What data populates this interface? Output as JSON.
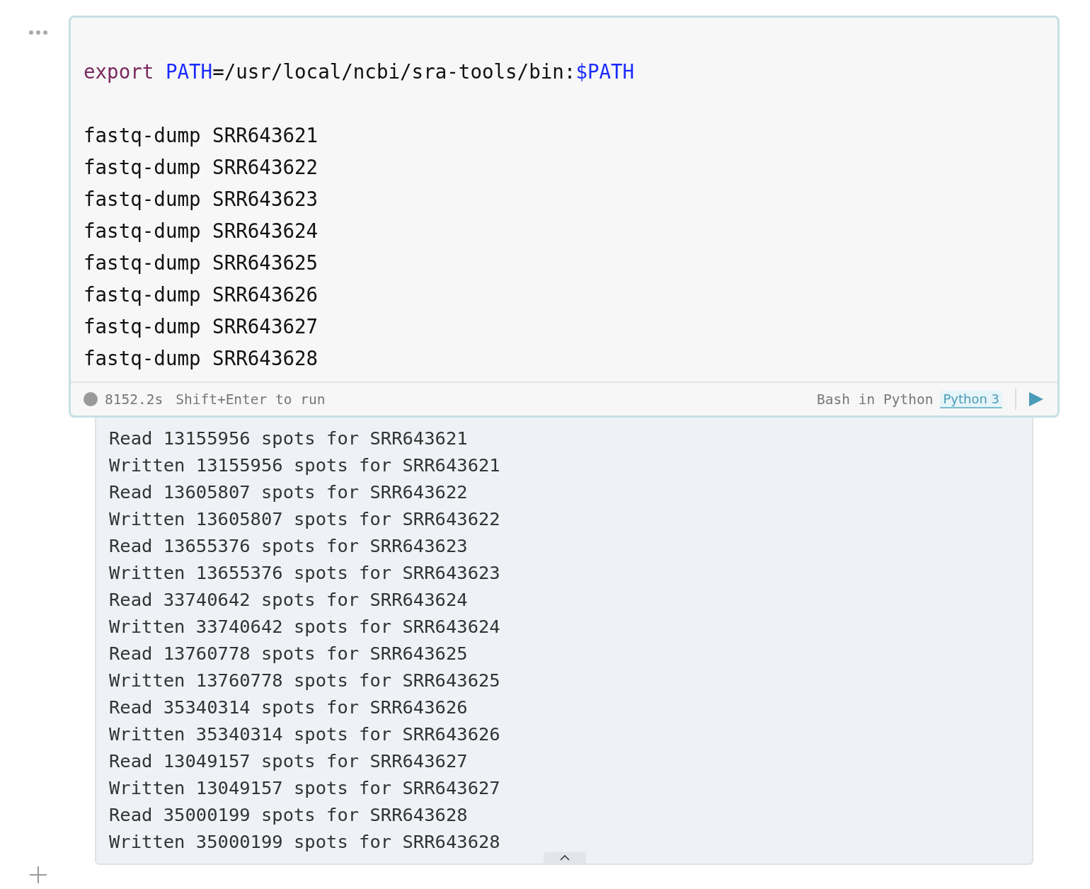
{
  "cell": {
    "code_blocks": [
      [
        [
          {
            "text": "export ",
            "kind": "keyword"
          },
          {
            "text": "PATH",
            "kind": "variable"
          },
          {
            "text": "=/usr/local/ncbi/sra-tools/bin:",
            "kind": "plain"
          },
          {
            "text": "$PATH",
            "kind": "variable"
          }
        ]
      ],
      [
        [
          {
            "text": "fastq-dump SRR643621",
            "kind": "plain"
          }
        ],
        [
          {
            "text": "fastq-dump SRR643622",
            "kind": "plain"
          }
        ],
        [
          {
            "text": "fastq-dump SRR643623",
            "kind": "plain"
          }
        ],
        [
          {
            "text": "fastq-dump SRR643624",
            "kind": "plain"
          }
        ],
        [
          {
            "text": "fastq-dump SRR643625",
            "kind": "plain"
          }
        ],
        [
          {
            "text": "fastq-dump SRR643626",
            "kind": "plain"
          }
        ],
        [
          {
            "text": "fastq-dump SRR643627",
            "kind": "plain"
          }
        ],
        [
          {
            "text": "fastq-dump SRR643628",
            "kind": "plain"
          }
        ]
      ]
    ],
    "footer": {
      "duration": "8152.2s",
      "hint": "Shift+Enter to run",
      "language": "Bash in Python",
      "kernel": "Python 3"
    },
    "output": {
      "lines": [
        "Read 13155956 spots for SRR643621",
        "Written 13155956 spots for SRR643621",
        "Read 13605807 spots for SRR643622",
        "Written 13605807 spots for SRR643622",
        "Read 13655376 spots for SRR643623",
        "Written 13655376 spots for SRR643623",
        "Read 33740642 spots for SRR643624",
        "Written 33740642 spots for SRR643624",
        "Read 13760778 spots for SRR643625",
        "Written 13760778 spots for SRR643625",
        "Read 35340314 spots for SRR643626",
        "Written 35340314 spots for SRR643626",
        "Read 13049157 spots for SRR643627",
        "Written 13049157 spots for SRR643627",
        "Read 35000199 spots for SRR643628",
        "Written 35000199 spots for SRR643628"
      ]
    }
  }
}
